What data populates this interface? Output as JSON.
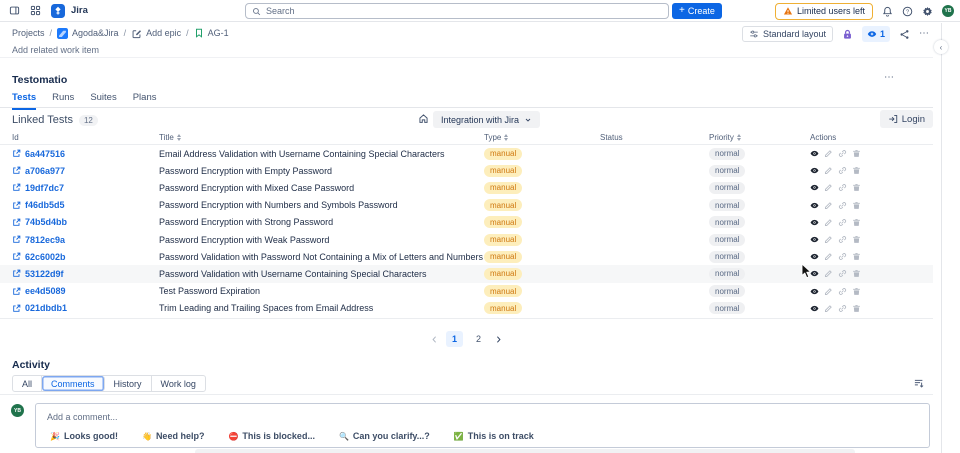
{
  "topnav": {
    "app_name": "Jira",
    "search": {
      "placeholder": "Search"
    },
    "create_button": "Create",
    "warning_button": "Limited users left",
    "avatar_initials": "YB"
  },
  "breadcrumb": {
    "separator": "/",
    "projects": "Projects",
    "project": "Agoda&Jira",
    "epic": "Add epic",
    "issue": "AG-1"
  },
  "toolbar": {
    "layout_button": "Standard layout",
    "watchers_count": "1",
    "more_button": "⋯"
  },
  "content": {
    "add_related_item": "Add related work item"
  },
  "panel": {
    "title": "Testomatio",
    "more_button": "⋯",
    "tabs": [
      {
        "label": "Tests",
        "state": "is-active"
      },
      {
        "label": "Runs"
      },
      {
        "label": "Suites"
      },
      {
        "label": "Plans"
      }
    ],
    "linked_header": {
      "title": "Linked Tests",
      "count": "12",
      "project_selector": "Integration with Jira",
      "login_button": "Login"
    },
    "table": {
      "columns": [
        "Id",
        "Title",
        "Type",
        "Status",
        "Priority",
        "Actions"
      ],
      "rows": [
        {
          "id": "6a447516",
          "title": "Email Address Validation with Username Containing Special Characters",
          "type": "manual",
          "priority": "normal"
        },
        {
          "id": "a706a977",
          "title": "Password Encryption with Empty Password",
          "type": "manual",
          "priority": "normal"
        },
        {
          "id": "19df7dc7",
          "title": "Password Encryption with Mixed Case Password",
          "type": "manual",
          "priority": "normal"
        },
        {
          "id": "f46db5d5",
          "title": "Password Encryption with Numbers and Symbols Password",
          "type": "manual",
          "priority": "normal"
        },
        {
          "id": "74b5d4bb",
          "title": "Password Encryption with Strong Password",
          "type": "manual",
          "priority": "normal"
        },
        {
          "id": "7812ec9a",
          "title": "Password Encryption with Weak Password",
          "type": "manual",
          "priority": "normal"
        },
        {
          "id": "62c6002b",
          "title": "Password Validation with Password Not Containing a Mix of Letters and Numbers",
          "type": "manual",
          "priority": "normal"
        },
        {
          "id": "53122d9f",
          "title": "Password Validation with Username Containing Special Characters",
          "type": "manual",
          "priority": "normal",
          "state": "is-hover"
        },
        {
          "id": "ee4d5089",
          "title": "Test Password Expiration",
          "type": "manual",
          "priority": "normal"
        },
        {
          "id": "021dbdb1",
          "title": "Trim Leading and Trailing Spaces from Email Address",
          "type": "manual",
          "priority": "normal"
        }
      ]
    },
    "pagination": {
      "pages": [
        {
          "label": "1",
          "state": "is-current"
        },
        {
          "label": "2"
        }
      ]
    }
  },
  "activity": {
    "title": "Activity",
    "tabs": [
      {
        "label": "All"
      },
      {
        "label": "Comments",
        "state": "is-active"
      },
      {
        "label": "History"
      },
      {
        "label": "Work log"
      }
    ],
    "comment_box": {
      "avatar_initials": "YB",
      "placeholder": "Add a comment...",
      "quick_replies": [
        {
          "emoji": "🎉",
          "label": "Looks good!"
        },
        {
          "emoji": "👋",
          "label": "Need help?"
        },
        {
          "emoji": "⛔",
          "label": "This is blocked..."
        },
        {
          "emoji": "🔍",
          "label": "Can you clarify...?"
        },
        {
          "emoji": "✅",
          "label": "This is on track"
        }
      ]
    }
  },
  "colors": {
    "accent_blue": "#0c66e4",
    "link_blue": "#1868db",
    "manual_badge_bg": "#fdeebc",
    "manual_badge_text": "#cf7911",
    "status_green": "#4bce97",
    "normal_badge_bg": "#eff0f2",
    "lock_purple": "#7a5fd0",
    "warning_orange": "#e8740f",
    "avatar_green": "#20734c",
    "watch_pill_bg": "#e9f2ff"
  }
}
